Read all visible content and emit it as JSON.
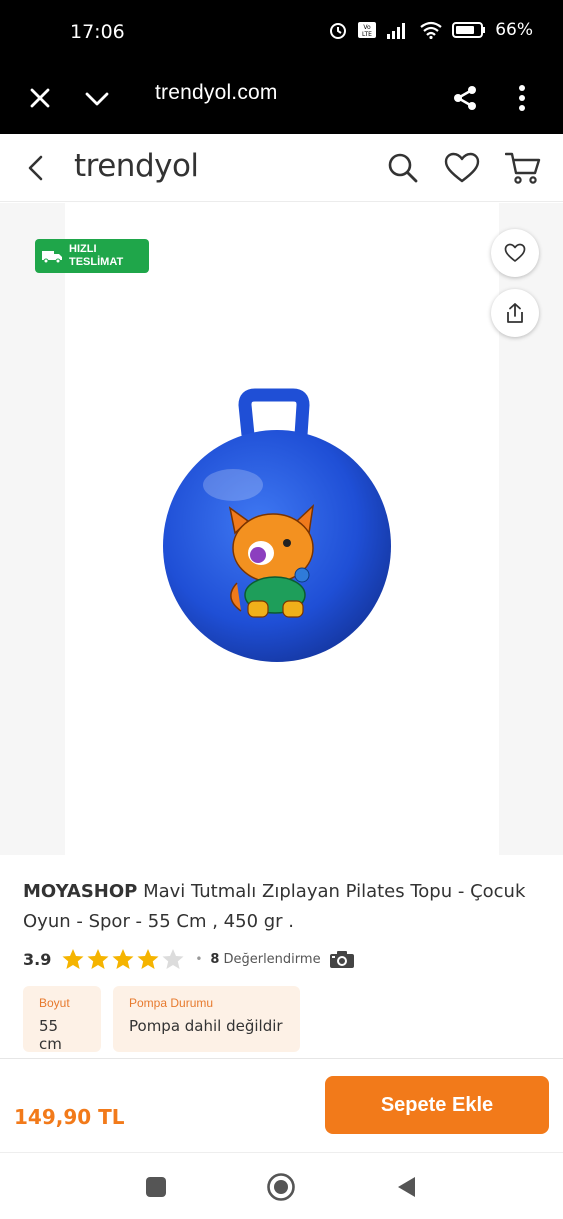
{
  "status_bar": {
    "time": "17:06",
    "battery": "66%"
  },
  "browser": {
    "url": "trendyol.com"
  },
  "header": {
    "logo": "trendyol"
  },
  "product": {
    "badge_line1": "HIZLI",
    "badge_line2": "TESLİMAT",
    "brand": "MOYASHOP",
    "title": "Mavi Tutmalı Zıplayan Pilates Topu - Çocuk Oyun - Spor - 55 Cm , 450 gr .",
    "rating": "3.9",
    "rating_stars": 3.9,
    "review_count": "8",
    "review_label": "Değerlendirme",
    "attributes": [
      {
        "key": "Boyut",
        "value": "55 cm"
      },
      {
        "key": "Pompa Durumu",
        "value": "Pompa dahil değildir"
      }
    ]
  },
  "footer": {
    "price": "149,90 TL",
    "add_to_cart": "Sepete Ekle"
  },
  "colors": {
    "accent": "#f27a1a",
    "badge_green": "#1fa64a",
    "star": "#f5b400",
    "ball": "#1f4fd6"
  }
}
